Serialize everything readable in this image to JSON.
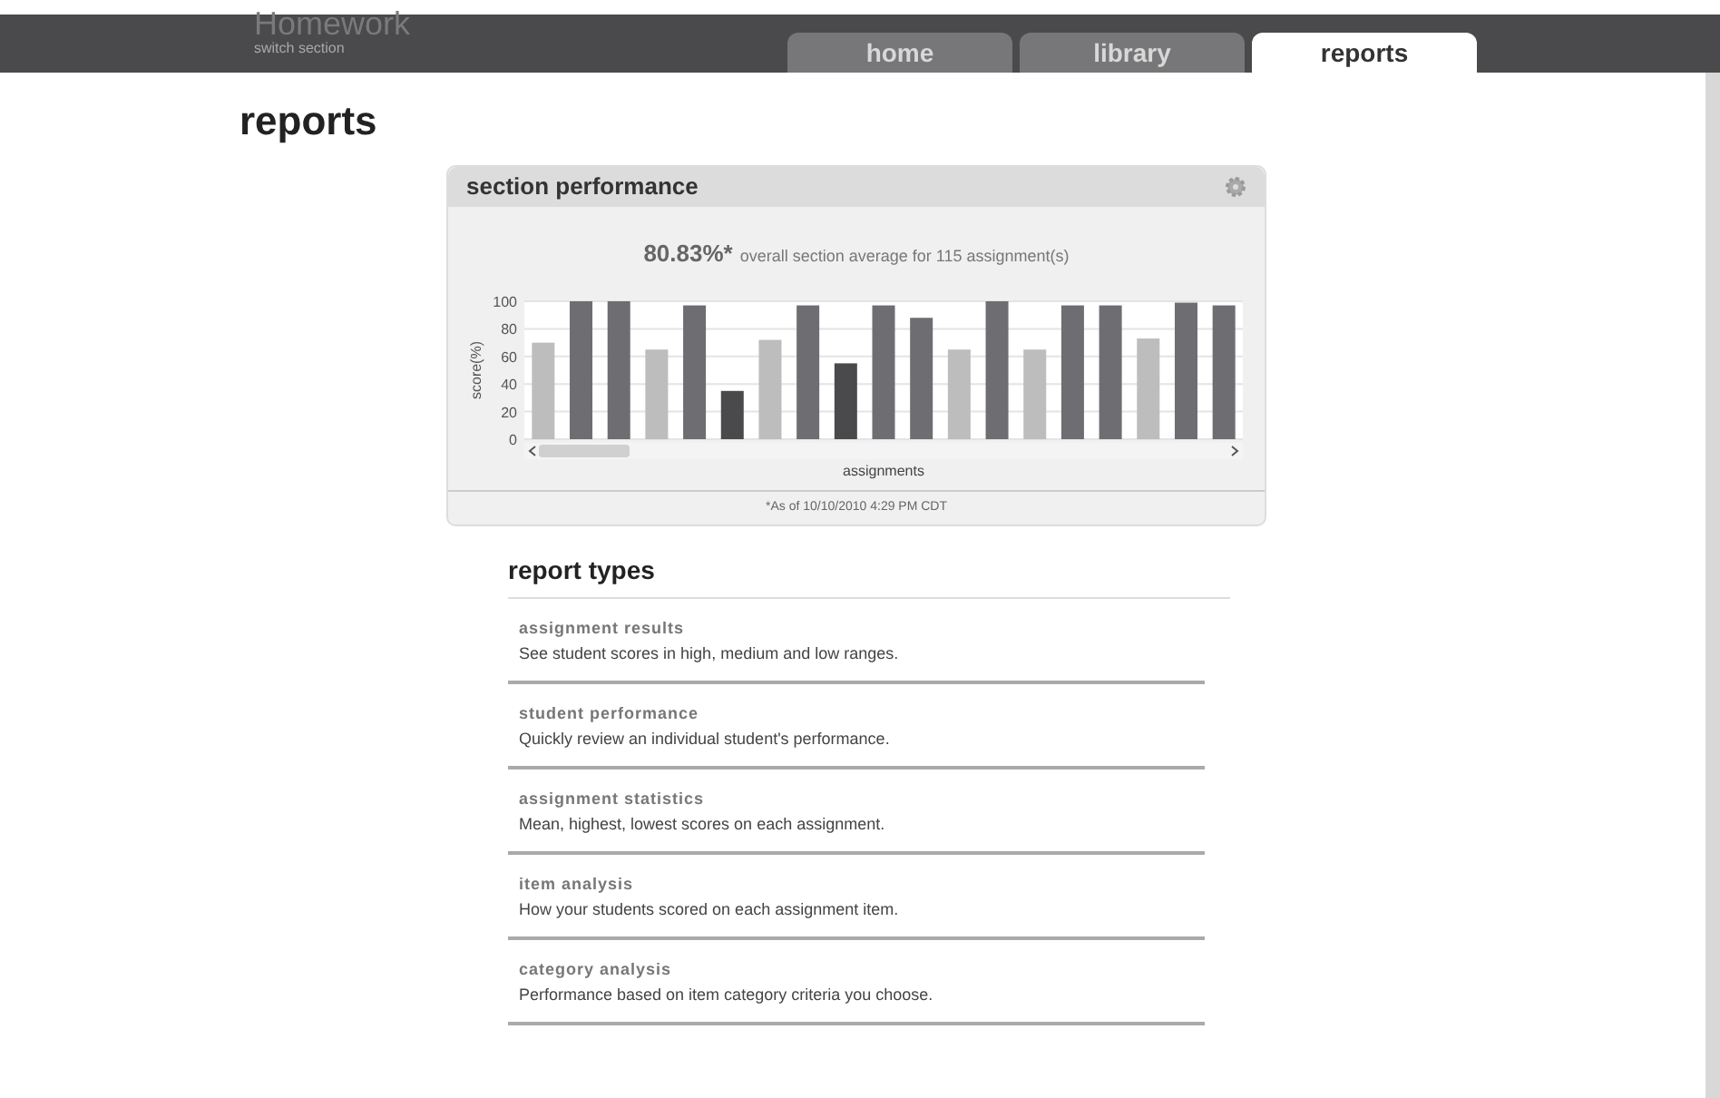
{
  "header": {
    "title": "Homework",
    "subtitle": "switch section"
  },
  "tabs": [
    {
      "label": "home",
      "selected": false
    },
    {
      "label": "library",
      "selected": false
    },
    {
      "label": "reports",
      "selected": true
    }
  ],
  "page_title": "reports",
  "section_performance": {
    "title": "section performance",
    "average": "80.83%*",
    "average_text": "overall section average for 115 assignment(s)",
    "footnote": "*As of 10/10/2010 4:29 PM CDT",
    "chart_data": {
      "type": "bar",
      "xlabel": "assignments",
      "ylabel": "score(%)",
      "ylim": [
        0,
        100
      ],
      "yticks": [
        0,
        20,
        40,
        60,
        80,
        100
      ],
      "grid": true,
      "series": [
        {
          "color": "#bdbdbd",
          "values": [
            70,
            null,
            null,
            65,
            null,
            null,
            72,
            null,
            null,
            null,
            null,
            65,
            null,
            65,
            null,
            null,
            73,
            null,
            null
          ]
        },
        {
          "color": "#6e6e72",
          "values": [
            null,
            100,
            100,
            null,
            97,
            null,
            null,
            97,
            null,
            97,
            88,
            null,
            100,
            null,
            97,
            97,
            null,
            99,
            97
          ]
        },
        {
          "color": "#4a4a4c",
          "values": [
            null,
            null,
            null,
            null,
            null,
            35,
            null,
            null,
            55,
            null,
            null,
            null,
            null,
            null,
            null,
            null,
            null,
            null,
            null
          ]
        }
      ]
    }
  },
  "report_types": {
    "title": "report types",
    "items": [
      {
        "name": "assignment results",
        "description": "See student scores in high, medium and low ranges."
      },
      {
        "name": "student performance",
        "description": "Quickly review an individual student's performance."
      },
      {
        "name": "assignment statistics",
        "description": "Mean, highest, lowest scores on each assignment."
      },
      {
        "name": "item analysis",
        "description": "How your students scored on each assignment item."
      },
      {
        "name": "category analysis",
        "description": "Performance based on item category criteria you choose."
      }
    ]
  }
}
